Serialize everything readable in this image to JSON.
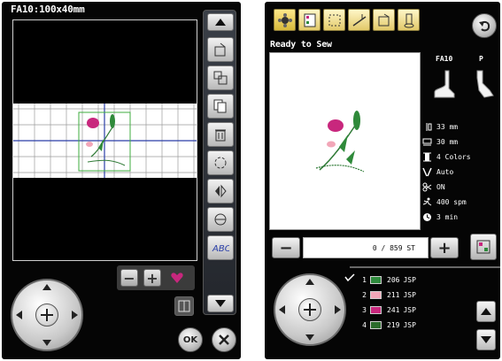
{
  "left_panel": {
    "title": "FA10:100x40mm",
    "ok_label": "OK"
  },
  "right_panel": {
    "status": "Ready to Sew",
    "foot_label": "FA10",
    "presser_label": "P",
    "info": {
      "height": "33 mm",
      "width": "30 mm",
      "colors": "4 Colors",
      "thread_cut": "Auto",
      "trim": "ON",
      "speed": "400 spm",
      "time": "3 min"
    },
    "stitch_counter": "0 / 859 ST",
    "thread_colors": [
      {
        "index": "1",
        "code": "206",
        "brand": "JSP",
        "color": "#2e8a3c"
      },
      {
        "index": "2",
        "code": "211",
        "brand": "JSP",
        "color": "#f2a6b8"
      },
      {
        "index": "3",
        "code": "241",
        "brand": "JSP",
        "color": "#c8277d"
      },
      {
        "index": "4",
        "code": "219",
        "brand": "JSP",
        "color": "#2c6b2c"
      }
    ]
  },
  "colors": {
    "screen_bg": "#050505",
    "tab_gold": "#e2c969"
  }
}
